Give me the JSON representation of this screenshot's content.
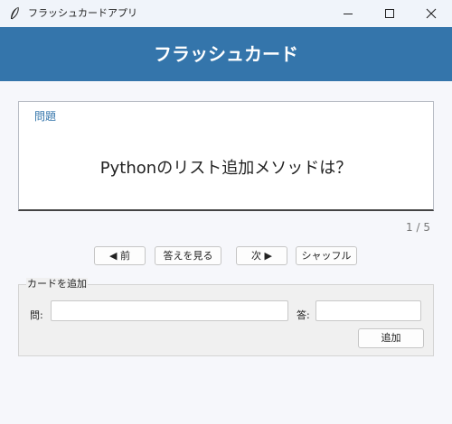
{
  "window": {
    "title": "フラッシュカードアプリ",
    "app_icon": "feather-icon",
    "controls": [
      "minimize-icon",
      "maximize-icon",
      "close-icon"
    ]
  },
  "header": {
    "title": "フラッシュカード",
    "background": "#3475ab"
  },
  "card": {
    "label": "問題",
    "text": "Pythonのリスト追加メソッドは？"
  },
  "counter": "1 / 5",
  "nav": {
    "prev_label": "◀ 前",
    "show_answer_label": "答えを見る",
    "next_label": "次 ▶",
    "shuffle_label": "シャッフル"
  },
  "add_card": {
    "title": "カードを追加",
    "question_label": "問:",
    "question_value": "",
    "answer_label": "答:",
    "answer_value": "",
    "add_label": "追加"
  }
}
